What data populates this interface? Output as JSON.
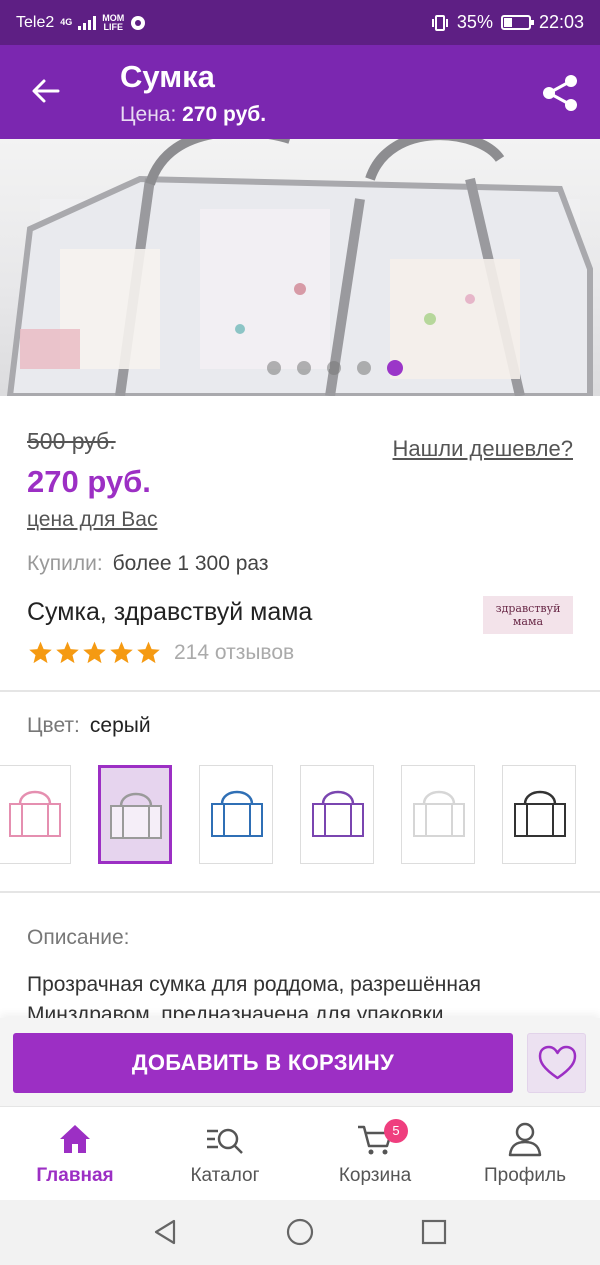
{
  "status_bar": {
    "carrier": "Tele2",
    "network": "4G",
    "app_badge_top": "MOM",
    "app_badge_bottom": "LIFE",
    "battery_percent": "35%",
    "battery_level": 0.35,
    "time": "22:03"
  },
  "app_bar": {
    "title": "Сумка",
    "price_prefix": "Цена:",
    "price_value": "270 руб."
  },
  "gallery": {
    "slide_count": 5,
    "active_slide": 5
  },
  "product": {
    "old_price": "500 руб.",
    "cheaper_link": "Нашли дешевле?",
    "price": "270 руб.",
    "price_for_you": "цена для Вас",
    "bought_label": "Купили:",
    "bought_value": "более 1 300 раз",
    "name": "Сумка, здравствуй мама",
    "brand_line1": "здравствуй",
    "brand_line2": "мама",
    "rating": 5,
    "reviews": "214 отзывов"
  },
  "color": {
    "label": "Цвет:",
    "value": "серый",
    "swatches": [
      {
        "name": "pink",
        "color": "#e58fb0"
      },
      {
        "name": "grey",
        "color": "#9a9a9a",
        "selected": true
      },
      {
        "name": "blue",
        "color": "#2f6fb5"
      },
      {
        "name": "purple",
        "color": "#7a45b0"
      },
      {
        "name": "white",
        "color": "#d6d6d6"
      },
      {
        "name": "black",
        "color": "#333333"
      }
    ]
  },
  "description": {
    "label": "Описание:",
    "text": "Прозрачная сумка для роддома, разрешённая Минздравом, предназначена для упаковки"
  },
  "actions": {
    "add_to_cart": "ДОБАВИТЬ В КОРЗИНУ",
    "favorite_icon": "heart-icon"
  },
  "nav": {
    "items": [
      {
        "label": "Главная",
        "icon": "home-icon",
        "active": true
      },
      {
        "label": "Каталог",
        "icon": "catalog-search-icon"
      },
      {
        "label": "Корзина",
        "icon": "cart-icon",
        "badge": "5"
      },
      {
        "label": "Профиль",
        "icon": "profile-icon"
      }
    ]
  },
  "colors": {
    "status_bar": "#5e1f84",
    "app_bar": "#7b27b0",
    "accent": "#9c2fc4",
    "badge": "#ef3e7e",
    "star": "#f59a12"
  }
}
